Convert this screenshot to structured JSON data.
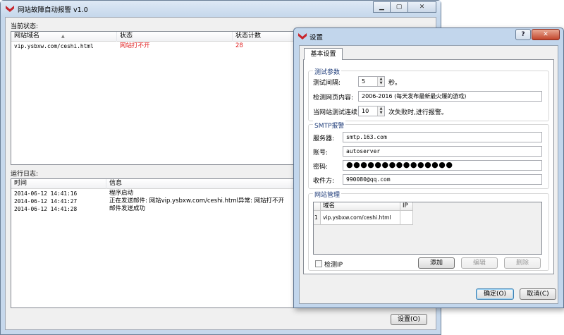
{
  "main": {
    "title": "网站故障自动报警 v1.0",
    "window_buttons": {
      "minimize": "▁",
      "maximize": "▢",
      "close": "✕"
    },
    "current_status_label": "当前状态:",
    "status_table": {
      "columns": [
        "网站域名",
        "状态",
        "状态计数"
      ],
      "rows": [
        {
          "domain": "vip.ysbxw.com/ceshi.html",
          "status": "网站打不开",
          "count": "28"
        }
      ]
    },
    "log_label": "运行日志:",
    "log_table": {
      "columns": [
        "时间",
        "信息"
      ],
      "rows": [
        {
          "time": "2014-06-12 14:41:16",
          "info": "程序启动"
        },
        {
          "time": "2014-06-12 14:41:27",
          "info": "正在发送邮件: 网站vip.ysbxw.com/ceshi.html异常: 网站打不开"
        },
        {
          "time": "2014-06-12 14:41:28",
          "info": "邮件发送成功"
        }
      ]
    },
    "settings_button": "设置(O)"
  },
  "dialog": {
    "title": "设置",
    "help": "?",
    "close": "✕",
    "tab": "基本设置",
    "test_params": {
      "title": "测试参数",
      "interval_label": "测试间隔:",
      "interval_value": "5",
      "interval_unit": "秒。",
      "content_label": "检测网页内容:",
      "content_value": "2006-2016 (每天发布最新最火爆的游戏)",
      "fail_label": "当网站测试连续",
      "fail_value": "10",
      "fail_suffix": "次失败时,进行报警。"
    },
    "smtp": {
      "title": "SMTP报警",
      "server_label": "服务器:",
      "server_value": "smtp.163.com",
      "account_label": "账号:",
      "account_value": "autoserver",
      "password_label": "密码:",
      "password_value": "●●●●●●●●●●●●●●●",
      "recipient_label": "收件方:",
      "recipient_value": "990080@qq.com"
    },
    "site_mgmt": {
      "title": "网站管理",
      "columns": [
        "域名",
        "IP"
      ],
      "rows": [
        {
          "index": "1",
          "domain": "vip.ysbxw.com/ceshi.html",
          "ip": ""
        }
      ],
      "check_ip_label": "检测IP",
      "check_ip_checked": false,
      "add_button": "添加",
      "edit_button": "编辑",
      "delete_button": "删除"
    },
    "ok_button": "确定(O)",
    "cancel_button": "取消(C)"
  },
  "colors": {
    "status_error": "#e02020",
    "group_title": "#1c3a78"
  }
}
